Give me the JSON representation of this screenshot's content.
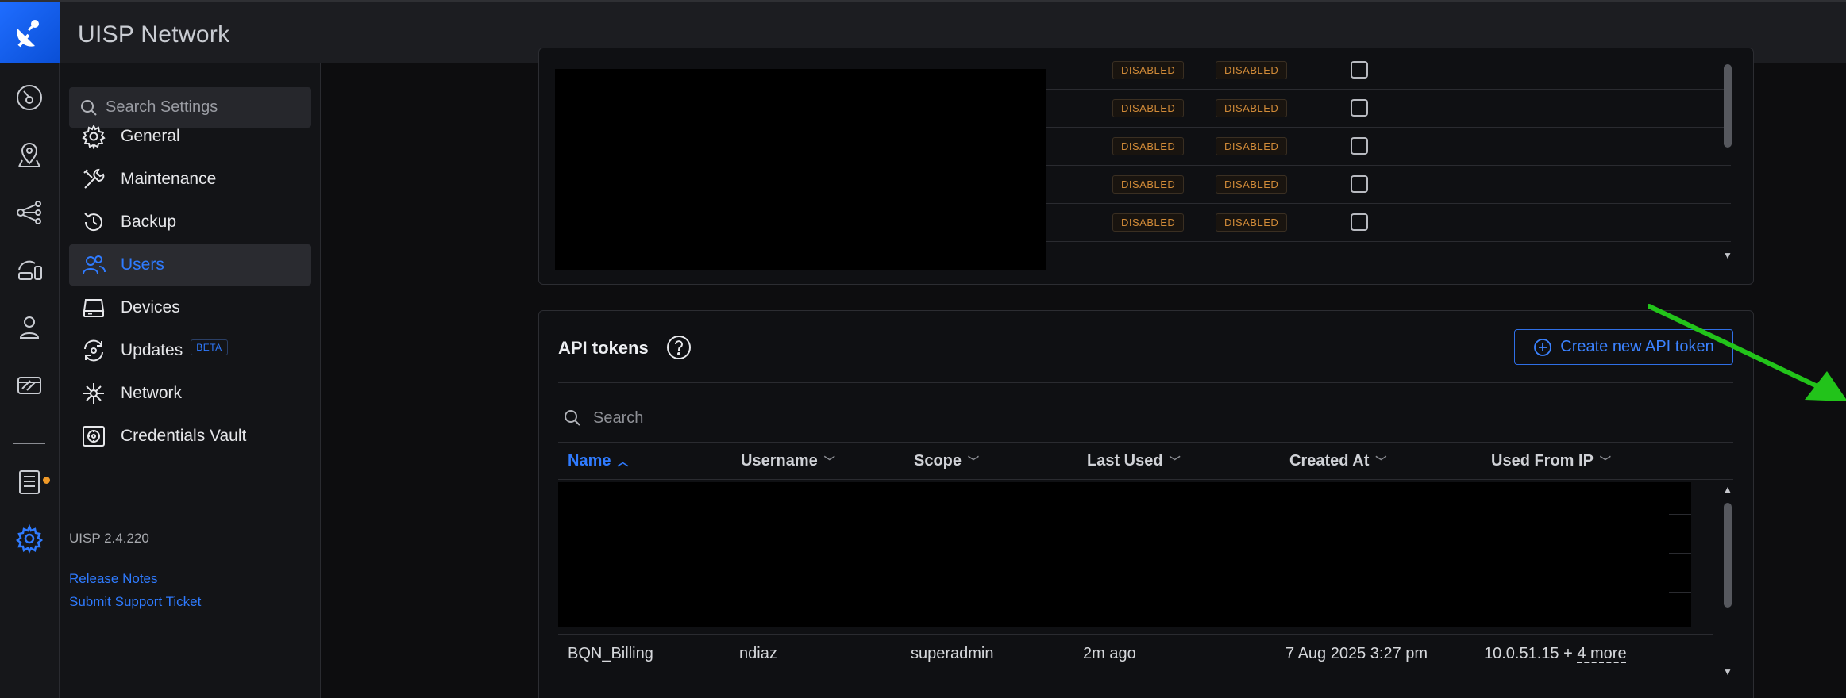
{
  "header": {
    "title": "UISP Network"
  },
  "rail": {
    "items": [
      {
        "name": "dashboard",
        "icon": "speedometer-icon"
      },
      {
        "name": "sites",
        "icon": "map-pin-icon"
      },
      {
        "name": "topology",
        "icon": "topology-icon"
      },
      {
        "name": "devices",
        "icon": "device-icon"
      },
      {
        "name": "clients",
        "icon": "person-icon"
      },
      {
        "name": "crm",
        "icon": "wallet-icon"
      },
      {
        "name": "logs",
        "icon": "list-icon"
      },
      {
        "name": "settings",
        "icon": "gear-icon"
      }
    ]
  },
  "sidebar": {
    "search_placeholder": "Search Settings",
    "items": [
      {
        "label": "General",
        "icon": "gear-icon"
      },
      {
        "label": "Maintenance",
        "icon": "tools-icon"
      },
      {
        "label": "Backup",
        "icon": "history-icon"
      },
      {
        "label": "Users",
        "icon": "users-icon",
        "active": true
      },
      {
        "label": "Devices",
        "icon": "drive-icon"
      },
      {
        "label": "Updates",
        "icon": "refresh-icon",
        "badge": "BETA"
      },
      {
        "label": "Network",
        "icon": "network-icon"
      },
      {
        "label": "Credentials Vault",
        "icon": "vault-icon"
      }
    ],
    "version": "UISP 2.4.220",
    "links": {
      "release_notes": "Release Notes",
      "support": "Submit Support Ticket"
    }
  },
  "users_table": {
    "rows": [
      {
        "col1": "DISABLED",
        "col2": "DISABLED"
      },
      {
        "col1": "DISABLED",
        "col2": "DISABLED"
      },
      {
        "col1": "DISABLED",
        "col2": "DISABLED"
      },
      {
        "col1": "DISABLED",
        "col2": "DISABLED"
      },
      {
        "col1": "DISABLED",
        "col2": "DISABLED"
      }
    ]
  },
  "api_tokens": {
    "title": "API tokens",
    "create_label": "Create new API token",
    "search_placeholder": "Search",
    "columns": [
      "Name",
      "Username",
      "Scope",
      "Last Used",
      "Created At",
      "Used From IP"
    ],
    "sorted_column": "Name",
    "row": {
      "name": "BQN_Billing",
      "username": "ndiaz",
      "scope": "superadmin",
      "last_used": "2m ago",
      "created_at": "7 Aug 2025 3:27 pm",
      "ip": "10.0.51.15 +",
      "ip_more": "4 more"
    }
  },
  "colors": {
    "accent": "#2f7bff",
    "disabled_pill": "#d08a38",
    "annotation_arrow": "#22c31a"
  }
}
